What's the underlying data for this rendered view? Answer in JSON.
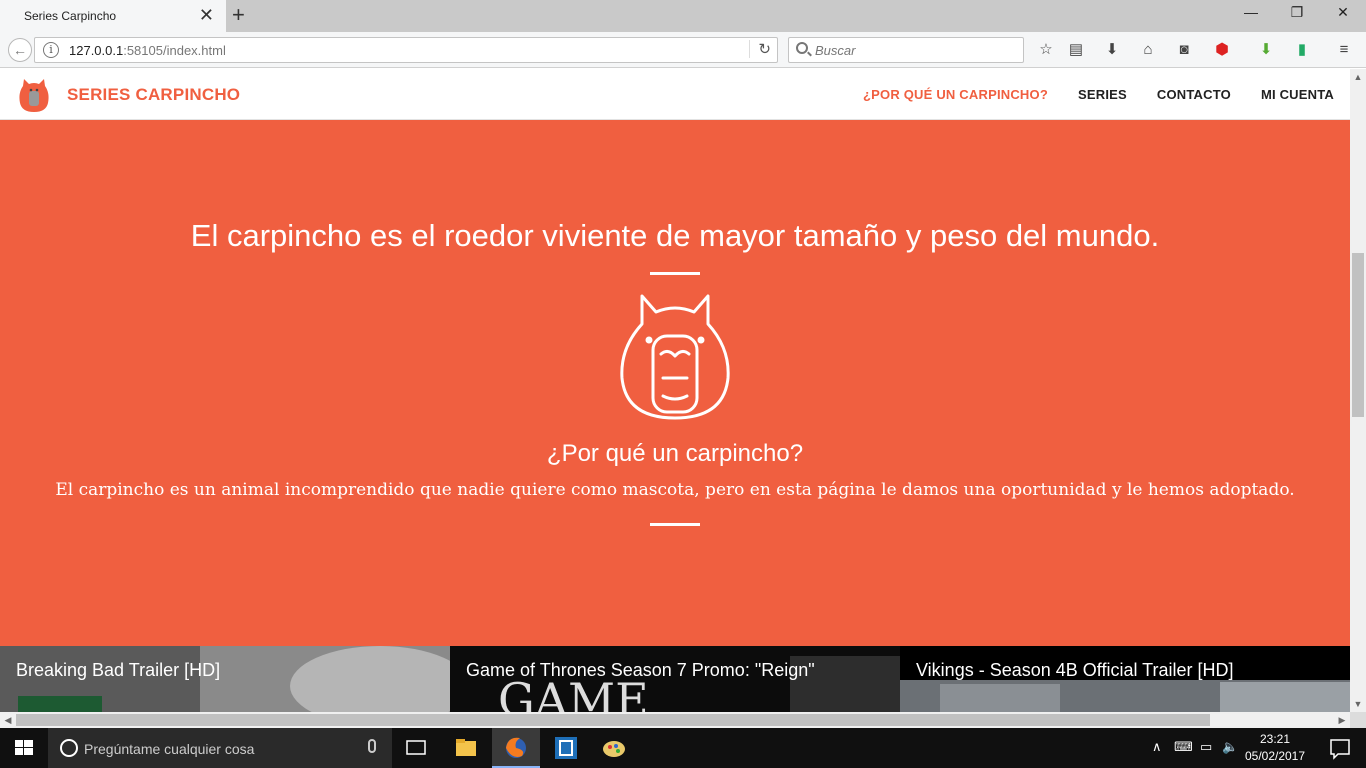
{
  "browser": {
    "tab_title": "Series Carpincho",
    "tab_close": "✕",
    "new_tab": "+",
    "url_host": "127.0.0.1",
    "url_rest": ":58105/index.html",
    "search_placeholder": "Buscar",
    "win_minimize": "—",
    "win_restore": "❐",
    "win_close": "✕"
  },
  "site": {
    "brand": "SERIES CARPINCHO",
    "menu": [
      {
        "label": "¿POR QUÉ UN CARPINCHO?",
        "active": true
      },
      {
        "label": "SERIES",
        "active": false
      },
      {
        "label": "CONTACTO",
        "active": false
      },
      {
        "label": "MI CUENTA",
        "active": false
      }
    ]
  },
  "hero": {
    "headline": "El carpincho es el roedor viviente de mayor tamaño y peso del mundo.",
    "subtitle": "¿Por qué un carpincho?",
    "text": "El carpincho es un animal incomprendido que nadie quiere como mascota, pero en esta página le damos una oportunidad y le hemos adoptado."
  },
  "videos": [
    {
      "title": "Breaking Bad Trailer [HD]"
    },
    {
      "title": "Game of Thrones Season 7 Promo: \"Reign\""
    },
    {
      "title": "Vikings - Season 4B Official Trailer [HD]"
    }
  ],
  "taskbar": {
    "search_placeholder": "Pregúntame cualquier cosa",
    "time": "23:21",
    "date": "05/02/2017"
  },
  "colors": {
    "accent": "#f05f40"
  }
}
